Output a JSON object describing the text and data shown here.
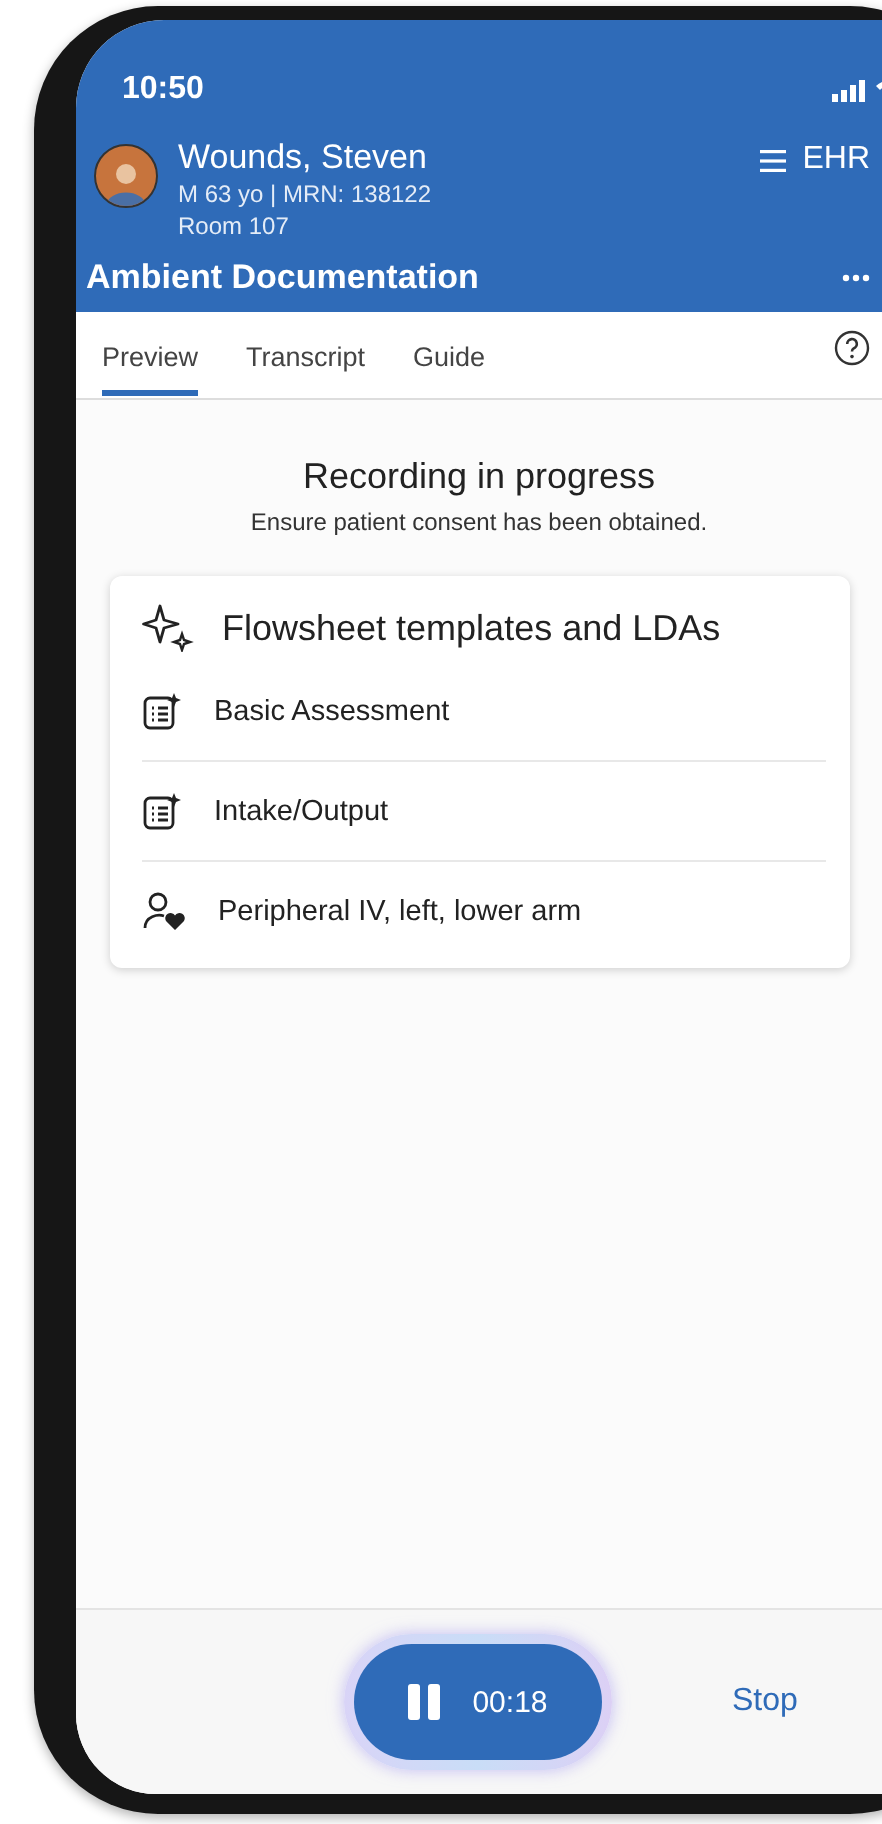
{
  "status_bar": {
    "time": "10:50"
  },
  "patient": {
    "name": "Wounds, Steven",
    "details": "M 63 yo | MRN: 138122",
    "room": "Room 107"
  },
  "menu_label": "EHR",
  "title": "Ambient Documentation",
  "tabs": [
    {
      "label": "Preview",
      "selected": true
    },
    {
      "label": "Transcript",
      "selected": false
    },
    {
      "label": "Guide",
      "selected": false
    }
  ],
  "recording": {
    "heading": "Recording in progress",
    "note": "Ensure patient consent has been obtained."
  },
  "card": {
    "title": "Flowsheet templates and LDAs",
    "items": [
      {
        "kind": "template",
        "label": "Basic Assessment"
      },
      {
        "kind": "template",
        "label": "Intake/Output"
      },
      {
        "kind": "lda",
        "label": "Peripheral IV, left, lower arm"
      }
    ]
  },
  "recorder": {
    "elapsed": "00:18",
    "stop": "Stop"
  }
}
